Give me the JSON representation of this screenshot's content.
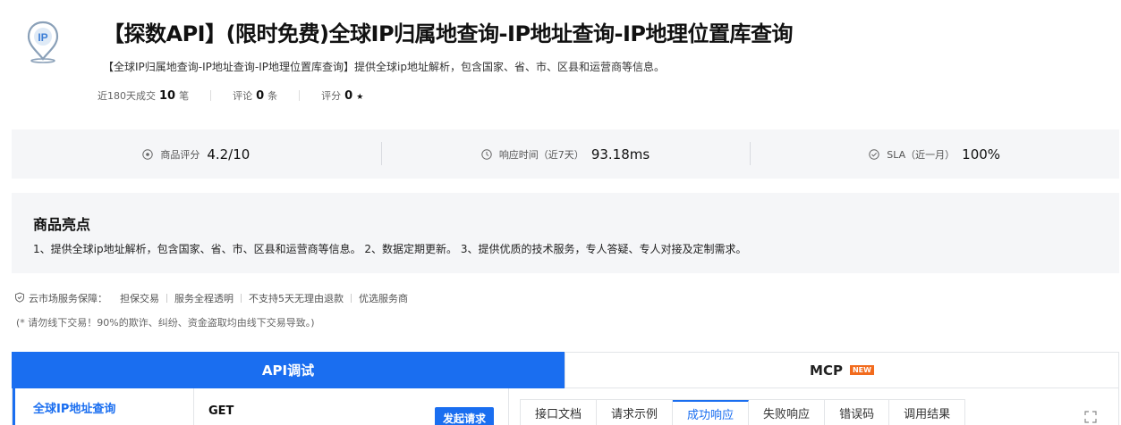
{
  "header": {
    "title": "【探数API】(限时免费)全球IP归属地查询-IP地址查询-IP地理位置库查询",
    "subtitle": "【全球IP归属地查询-IP地址查询-IP地理位置库查询】提供全球ip地址解析，包含国家、省、市、区县和运营商等信息。",
    "logo_text": "IP",
    "stats": [
      {
        "label": "近180天成交",
        "value": "10",
        "unit": "笔"
      },
      {
        "label": "评论",
        "value": "0",
        "unit": "条"
      },
      {
        "label": "评分",
        "value": "0",
        "unit": "★"
      }
    ]
  },
  "metrics": [
    {
      "icon": "star-circle-icon",
      "label": "商品评分",
      "value": "4.2/10"
    },
    {
      "icon": "clock-icon",
      "label": "响应时间（近7天）",
      "value": "93.18ms"
    },
    {
      "icon": "check-circle-icon",
      "label": "SLA（近一月）",
      "value": "100%"
    }
  ],
  "highlights": {
    "title": "商品亮点",
    "text": "1、提供全球ip地址解析，包含国家、省、市、区县和运营商等信息。 2、数据定期更新。 3、提供优质的技术服务，专人答疑、专人对接及定制需求。"
  },
  "guarantee": {
    "lead": "云市场服务保障：",
    "items": [
      "担保交易",
      "服务全程透明",
      "不支持5天无理由退款",
      "优选服务商"
    ],
    "warning": "(* 请勿线下交易！90%的欺诈、纠纷、资金盗取均由线下交易导致。)"
  },
  "tabs": {
    "api": "API调试",
    "mcp": "MCP",
    "new_badge": "NEW"
  },
  "panel": {
    "side_item": "全球IP地址查询",
    "method": "GET",
    "send_button": "发起请求",
    "doc_tabs": [
      "接口文档",
      "请求示例",
      "成功响应",
      "失败响应",
      "错误码",
      "调用结果"
    ]
  },
  "colors": {
    "accent": "#1a6ef0",
    "badge": "#f26b1d"
  }
}
